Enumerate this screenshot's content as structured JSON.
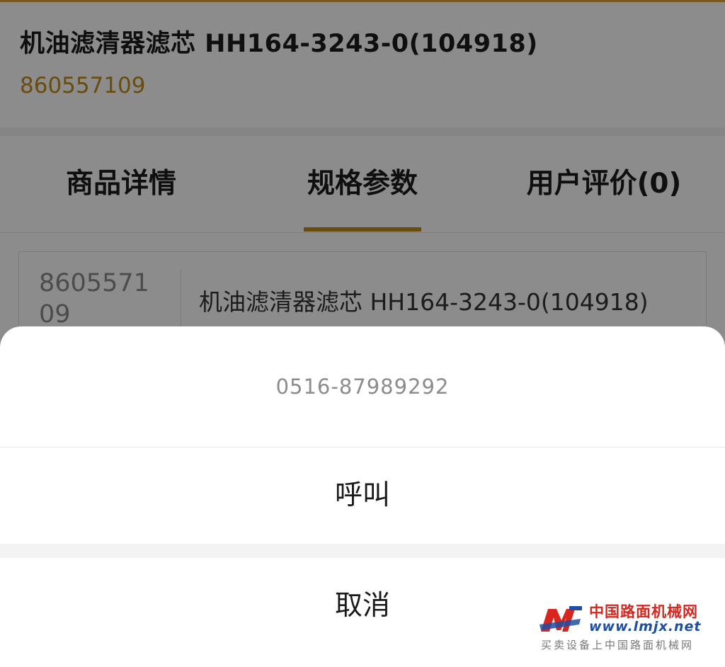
{
  "product": {
    "title": "机油滤清器滤芯 HH164-3243-0(104918)",
    "code": "860557109"
  },
  "tabs": [
    {
      "label": "商品详情",
      "active": false
    },
    {
      "label": "规格参数",
      "active": true
    },
    {
      "label": "用户评价(0)",
      "active": false
    }
  ],
  "spec_table": {
    "rows": [
      {
        "key": "860557109",
        "value": "机油滤清器滤芯 HH164-3243-0(104918)"
      }
    ]
  },
  "action_sheet": {
    "phone": "0516-87989292",
    "call_label": "呼叫",
    "cancel_label": "取消"
  },
  "watermark": {
    "name_cn": "中国路面机械网",
    "url": "www.lmjx.net",
    "slogan": "买卖设备上中国路面机械网"
  },
  "colors": {
    "accent": "#c08a1e",
    "overlay": "rgba(0,0,0,0.45)",
    "watermark_red": "#d8261f",
    "watermark_blue": "#1f4fa3"
  }
}
